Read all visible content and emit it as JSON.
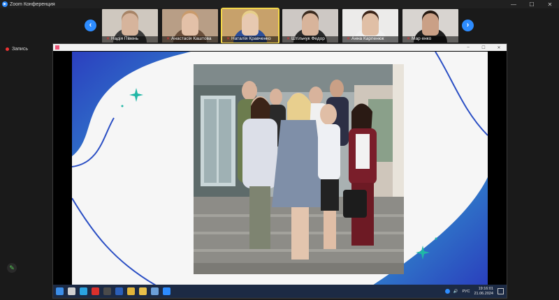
{
  "window": {
    "title": "Zoom Конференция",
    "controls": [
      "—",
      "☐",
      "✕"
    ]
  },
  "participants": [
    {
      "name": "Надія Півень",
      "muted": true,
      "skin": "#d6b49c",
      "hair": "#a78466",
      "shirt": "#3b3b3b",
      "bg": "#cfc8bf"
    },
    {
      "name": "Анастасія Каштова",
      "muted": true,
      "skin": "#e3c1a8",
      "hair": "#c99b6c",
      "shirt": "#6a4f3b",
      "bg": "#b89e86"
    },
    {
      "name": "Наталія Кравченко",
      "muted": true,
      "skin": "#e7c9b1",
      "hair": "#e7cf8a",
      "shirt": "#2d4f9a",
      "bg": "#c7a16b",
      "active": true
    },
    {
      "name": "Штільчук Федор",
      "muted": true,
      "skin": "#d8b49b",
      "hair": "#3a2a1e",
      "shirt": "#2a2a2a",
      "bg": "#cdc8c4"
    },
    {
      "name": "Анна Карпенюк",
      "muted": true,
      "skin": "#e0bfa6",
      "hair": "#3b2418",
      "shirt": "#f0f0f0",
      "bg": "#ecebea"
    },
    {
      "name": "Мар енко",
      "muted": true,
      "skin": "#caa086",
      "hair": "#241810",
      "shirt": "#1e1e1e",
      "bg": "#d8d4d0"
    }
  ],
  "nav": {
    "prev": "‹",
    "next": "›"
  },
  "recording": {
    "label": "Запись"
  },
  "annotate_icon": "pen-icon",
  "shared_window": {
    "controls": [
      "–",
      "☐",
      "✕"
    ]
  },
  "taskbar": {
    "icons": [
      {
        "name": "windows-start-icon",
        "color": "#3c8ee8"
      },
      {
        "name": "search-icon",
        "color": "#d0d0d0"
      },
      {
        "name": "telegram-icon",
        "color": "#2aa3e0"
      },
      {
        "name": "pdf-icon",
        "color": "#d9302c"
      },
      {
        "name": "calculator-icon",
        "color": "#4a4a4a"
      },
      {
        "name": "word-icon",
        "color": "#2b5fb8"
      },
      {
        "name": "chrome-icon",
        "color": "#e0b43a"
      },
      {
        "name": "explorer-icon",
        "color": "#e8c04a"
      },
      {
        "name": "photos-icon",
        "color": "#6ca0d8"
      },
      {
        "name": "zoom-icon",
        "color": "#2d8cff"
      }
    ],
    "lang": "РУС",
    "time": "19:16:01",
    "date": "21.06.2024"
  },
  "colors": {
    "accent": "#2d8cff",
    "slide_blue": "#2b4fc4",
    "slide_teal": "#20b7a6"
  }
}
